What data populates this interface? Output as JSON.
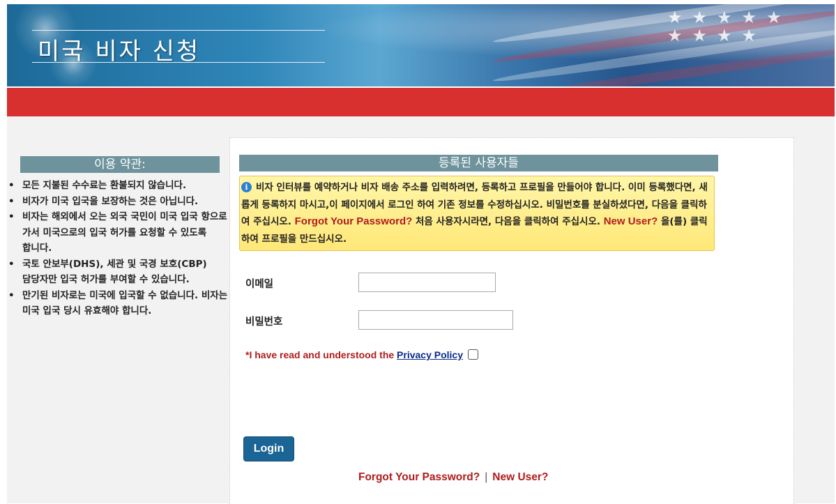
{
  "header": {
    "title": "미국 비자 신청"
  },
  "terms": {
    "title": "이용 약관:",
    "items": [
      "모든 지불된 수수료는 환불되지 않습니다.",
      "비자가 미국 입국을 보장하는 것은 아닙니다.",
      "비자는 해외에서 오는 외국 국민이 미국 입국 항으로 가서 미국으로의 입국 허가를 요청할 수 있도록 합니다.",
      "국토 안보부(DHS), 세관 및 국경 보호(CBP) 담당자만 입국 허가를 부여할 수 있습니다.",
      "만기된 비자로는 미국에 입국할 수 없습니다. 비자는 미국 입국 당시 유효해야 합니다."
    ]
  },
  "registered": {
    "title": "등록된 사용자들",
    "info_text_1": "비자 인터뷰를 예약하거나 비자 배송 주소를 입력하려면, 등록하고 프로필을 만들어야 합니다. 이미 등록했다면, 새롭게 등록하지 마시고,이 페이지에서 로그인 하여 기존 정보를 수정하십시오. 비밀번호를 분실하셨다면, 다음을 클릭하여 주십시오. ",
    "forgot_link": "Forgot Your Password?",
    "info_text_2": " 처음 사용자시라면, 다음을 클릭하여 주십시오. ",
    "new_user_link": "New User?",
    "info_text_3": " 을(를) 클릭하여 프로필을 만드십시오."
  },
  "form": {
    "email_label": "이메일",
    "email_value": "",
    "password_label": "비밀번호",
    "password_value": "",
    "privacy_prefix": "*I have read and understood the ",
    "privacy_link": "Privacy Policy",
    "privacy_checked": false,
    "login_label": "Login"
  },
  "links": {
    "forgot": "Forgot Your Password?",
    "separator": "|",
    "new_user": "New User?"
  },
  "colors": {
    "red_bar": "#d82f2f",
    "section_header": "#6e939c",
    "link_red": "#b01c1c",
    "button_blue": "#1a6496",
    "info_yellow": "#ffe878"
  }
}
